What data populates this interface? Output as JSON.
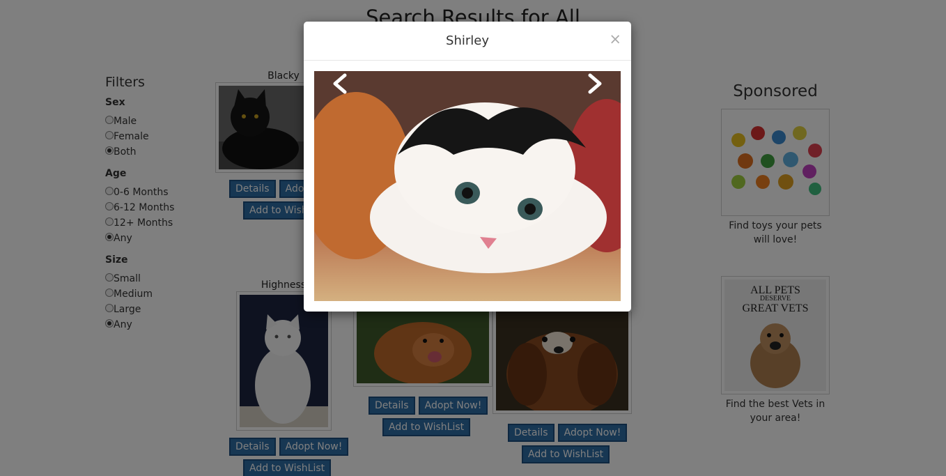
{
  "page": {
    "title": "Search Results for All"
  },
  "filters": {
    "title": "Filters",
    "groups": [
      {
        "title": "Sex",
        "options": [
          {
            "label": "Male",
            "checked": false
          },
          {
            "label": "Female",
            "checked": false
          },
          {
            "label": "Both",
            "checked": true
          }
        ]
      },
      {
        "title": "Age",
        "options": [
          {
            "label": "0-6 Months",
            "checked": false
          },
          {
            "label": "6-12 Months",
            "checked": false
          },
          {
            "label": "12+ Months",
            "checked": false
          },
          {
            "label": "Any",
            "checked": true
          }
        ]
      },
      {
        "title": "Size",
        "options": [
          {
            "label": "Small",
            "checked": false
          },
          {
            "label": "Medium",
            "checked": false
          },
          {
            "label": "Large",
            "checked": false
          },
          {
            "label": "Any",
            "checked": true
          }
        ]
      }
    ]
  },
  "pets": [
    {
      "name": "Blacky"
    },
    {
      "name": "Highness"
    },
    {
      "name": ""
    },
    {
      "name": ""
    }
  ],
  "buttons": {
    "details": "Details",
    "adopt": "Adopt Now!",
    "wishlist": "Add to WishList",
    "wishlist_top": "Add to Wishl"
  },
  "sponsored": {
    "title": "Sponsored",
    "ads": [
      {
        "text": "Find toys your pets will love!"
      },
      {
        "text": "Find the best Vets in your area!",
        "image_text": [
          "ALL PETS",
          "DESERVE",
          "GREAT VETS"
        ]
      }
    ]
  },
  "modal": {
    "title": "Shirley",
    "close": "×",
    "prev_icon": "chevron-left-icon",
    "next_icon": "chevron-right-icon"
  },
  "colors": {
    "button": "#2f6fa7",
    "backdrop": "rgba(0,0,0,0.5)"
  }
}
